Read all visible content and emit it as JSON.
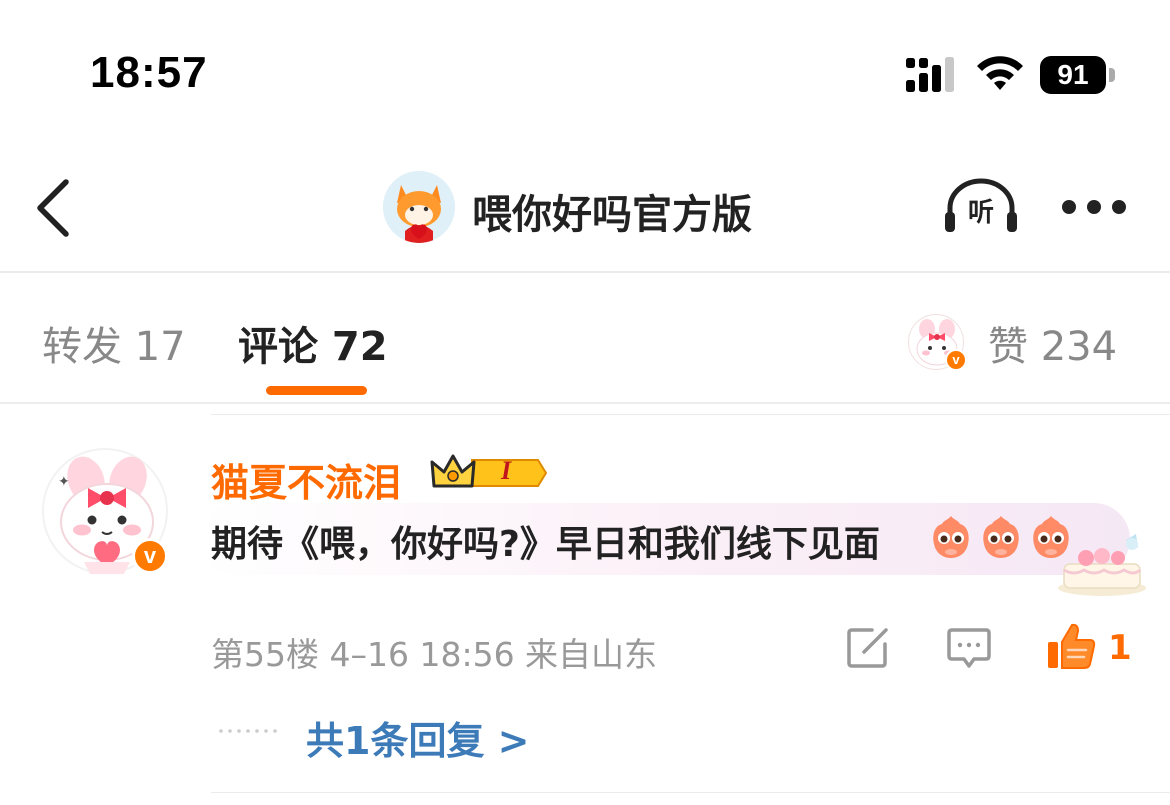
{
  "status": {
    "time": "18:57",
    "battery": "91"
  },
  "nav": {
    "title": "喂你好吗官方版",
    "listen_label": "听"
  },
  "tabs": {
    "repost": "转发 17",
    "comment": "评论 72",
    "like": "赞 234"
  },
  "comment": {
    "username": "猫夏不流泪",
    "level_badge": "I",
    "text": "期待《喂，你好吗?》早日和我们线下见面",
    "meta": "第55楼 4–16 18:56 来自山东",
    "like_count": "1",
    "reply_link": "共1条回复 >"
  },
  "icons": {
    "back": "chevron-left-icon",
    "listen": "headphones-icon",
    "more": "more-dots-icon",
    "edit": "edit-icon",
    "reply": "comment-icon",
    "like": "thumbs-up-icon"
  },
  "colors": {
    "accent": "#ff6a00",
    "link": "#3d7ab8",
    "muted": "#999999"
  }
}
